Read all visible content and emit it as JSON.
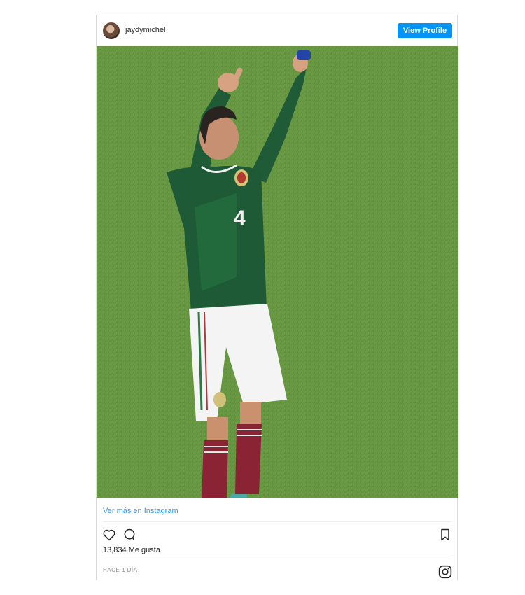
{
  "post": {
    "username": "jaydymichel",
    "view_profile_label": "View Profile",
    "more_link": "Ver más en Instagram",
    "likes": "13,834 Me gusta",
    "time": "HACE 1 DÍA"
  },
  "icons": {
    "avatar": "profile-avatar",
    "like": "heart-icon",
    "comment": "comment-icon",
    "save": "bookmark-icon",
    "brand": "instagram-icon"
  },
  "colors": {
    "accent": "#0095f6",
    "link": "#3897f0",
    "text": "#262626",
    "muted": "#8e8e8e"
  }
}
